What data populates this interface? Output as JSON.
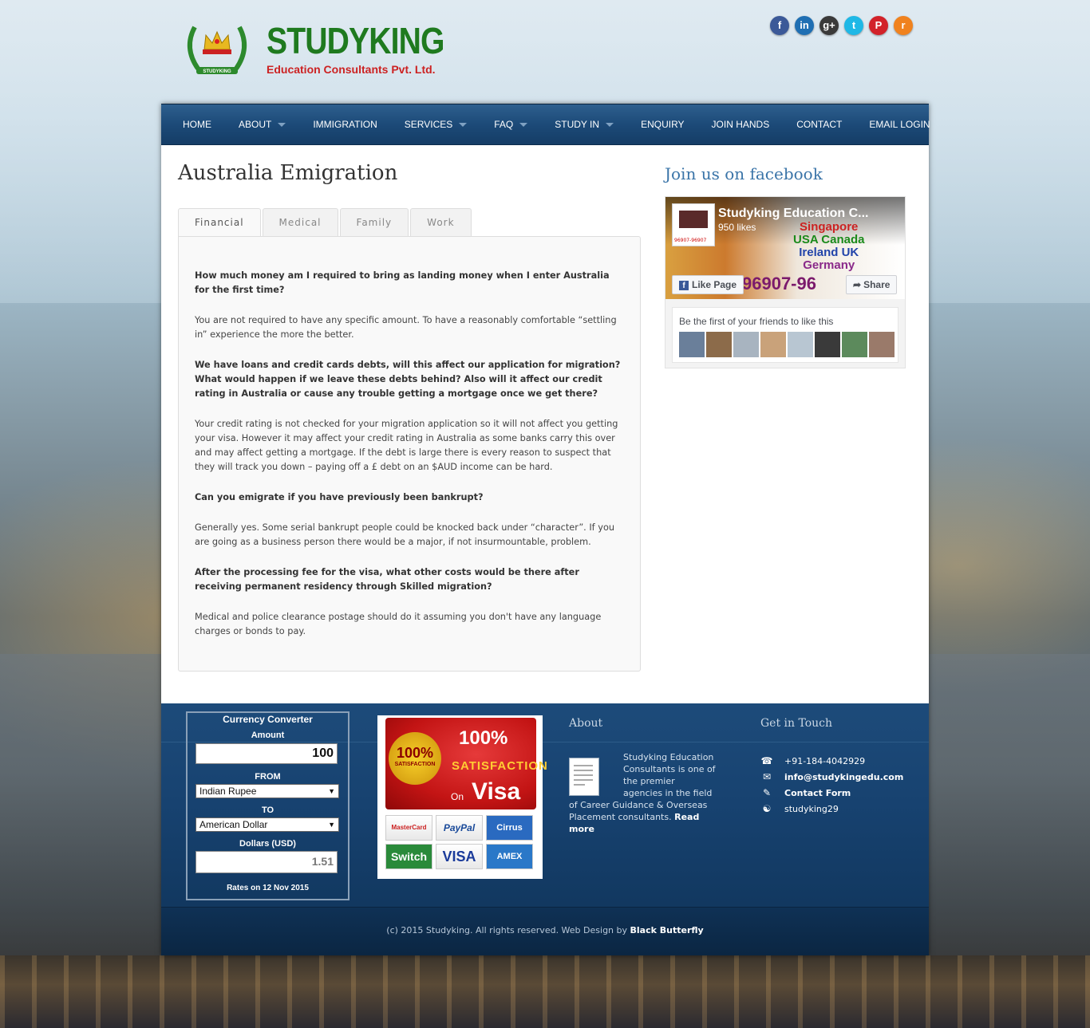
{
  "brand": {
    "name": "STUDYKING",
    "subtitle": "Education Consultants Pvt. Ltd.",
    "crest_text": "STUDYKING"
  },
  "social": [
    {
      "icon": "facebook-icon",
      "glyph": "f",
      "color": "#3b5998"
    },
    {
      "icon": "linkedin-icon",
      "glyph": "in",
      "color": "#1f6fb3"
    },
    {
      "icon": "google-plus-icon",
      "glyph": "g+",
      "color": "#3a3a3a"
    },
    {
      "icon": "twitter-icon",
      "glyph": "t",
      "color": "#1fb8e6"
    },
    {
      "icon": "pinterest-icon",
      "glyph": "P",
      "color": "#d2222a"
    },
    {
      "icon": "rss-icon",
      "glyph": "r",
      "color": "#f0821e"
    }
  ],
  "nav": {
    "items": [
      {
        "label": "HOME",
        "dropdown": false
      },
      {
        "label": "ABOUT",
        "dropdown": true
      },
      {
        "label": "IMMIGRATION",
        "dropdown": false
      },
      {
        "label": "SERVICES",
        "dropdown": true
      },
      {
        "label": "FAQ",
        "dropdown": true
      },
      {
        "label": "STUDY IN",
        "dropdown": true
      },
      {
        "label": "ENQUIRY",
        "dropdown": false
      },
      {
        "label": "JOIN HANDS",
        "dropdown": false
      },
      {
        "label": "CONTACT",
        "dropdown": false
      },
      {
        "label": "EMAIL LOGIN",
        "dropdown": false
      }
    ]
  },
  "main": {
    "title": "Australia Emigration",
    "tabs": [
      "Financial",
      "Medical",
      "Family",
      "Work"
    ],
    "active_tab": "Financial",
    "faq": [
      {
        "q": "How much money am I required to bring as landing money when I enter Australia for the first time?",
        "a": "You are not required to have any specific amount. To have a reasonably comfortable “settling in” experience the more the better."
      },
      {
        "q": "We have loans and credit cards debts, will this affect our application for migration? What would happen if we leave these debts behind? Also will it affect our credit rating in Australia or cause any trouble getting a mortgage once we get there?",
        "a": "Your credit rating is not checked for your migration application so it will not affect you getting your visa. However it may affect your credit rating in Australia as some banks carry this over and may affect getting a mortgage. If the debt is large there is every reason to suspect that they will track you down – paying off a £ debt on an $AUD income can be hard."
      },
      {
        "q": "Can you emigrate if you have previously been bankrupt?",
        "a": "Generally yes. Some serial bankrupt people could be knocked back under “character”. If you are going as a business person there would be a major, if not insurmountable, problem."
      },
      {
        "q": "After the processing fee for the visa, what other costs would be there after receiving permanent residency through Skilled migration?",
        "a": "Medical and police clearance postage should do it assuming you don't have any language charges or bonds to pay."
      }
    ]
  },
  "facebook": {
    "heading": "Join us on facebook",
    "page_name": "Studyking Education C...",
    "likes": "950 likes",
    "cover_countries": [
      "Singapore",
      "USA Canada",
      "Ireland UK",
      "Germany"
    ],
    "cover_phone": "96907-96",
    "thumb_number": "96907-96907",
    "like_button": "Like Page",
    "share_button": "Share",
    "friends_text": "Be the first of your friends to like this",
    "face_colors": [
      "#6a7f9a",
      "#8c6b4a",
      "#a8b4c0",
      "#c9a27a",
      "#b8c6d2",
      "#3a3a3a",
      "#5c8a5c",
      "#9a7a6a"
    ]
  },
  "footer": {
    "currency": {
      "title": "Currency Converter",
      "amount_label": "Amount",
      "amount_value": "100",
      "from_label": "FROM",
      "from_value": "Indian Rupee",
      "to_label": "TO",
      "to_value": "American Dollar",
      "result_label": "Dollars (USD)",
      "result_value": "1.51",
      "rates": "Rates on 12 Nov 2015"
    },
    "satisfaction": {
      "seal_big": "100%",
      "seal_small": "SATISFACTION",
      "pct": "100%",
      "satisfaction": "SATISFACTION",
      "on": "On",
      "visa": "Visa",
      "cards": [
        "MasterCard",
        "PayPal",
        "Cirrus",
        "Switch",
        "VISA",
        "AMEX"
      ]
    },
    "about": {
      "heading": "About",
      "text": "Studyking Education Consultants is one of the premier agencies in the field of Career Guidance & Overseas Placement consultants.",
      "read_more": "Read more"
    },
    "contact": {
      "heading": "Get in Touch",
      "phone": "+91-184-4042929",
      "email": "info@studykingedu.com",
      "form": "Contact Form",
      "skype": "studyking29"
    },
    "copyright_prefix": "(c) 2015 Studyking. All rights reserved. Web Design by",
    "designer": "Black Butterfly"
  }
}
